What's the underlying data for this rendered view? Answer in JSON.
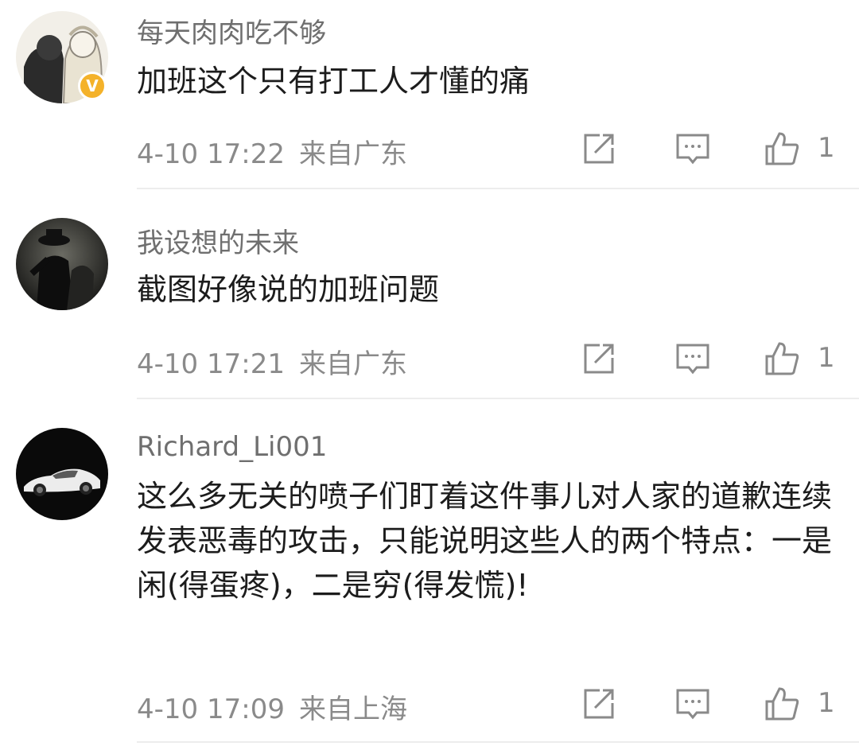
{
  "comments": [
    {
      "username": "每天肉肉吃不够",
      "verified_badge": "V",
      "text": "加班这个只有打工人才懂的痛",
      "time": "4-10 17:22",
      "location": "来自广东",
      "likes": "1"
    },
    {
      "username": "我设想的未来",
      "text": "截图好像说的加班问题",
      "time": "4-10 17:21",
      "location": "来自广东",
      "likes": "1"
    },
    {
      "username": "Richard_Li001",
      "text": "这么多无关的喷子们盯着这件事儿对人家的道歉连续发表恶毒的攻击，只能说明这些人的两个特点：一是闲(得蛋疼)，二是穷(得发慌)!",
      "time": "4-10 17:09",
      "location": "来自上海",
      "likes": "1"
    }
  ],
  "icons": {
    "repost": "share-square-icon",
    "comment": "comment-bubble-icon",
    "like": "thumbs-up-icon"
  },
  "colors": {
    "username": "#6f6f6f",
    "text": "#1c1c1c",
    "meta": "#8a8a8a",
    "badge": "#f4b22a",
    "divider": "#ededed"
  }
}
